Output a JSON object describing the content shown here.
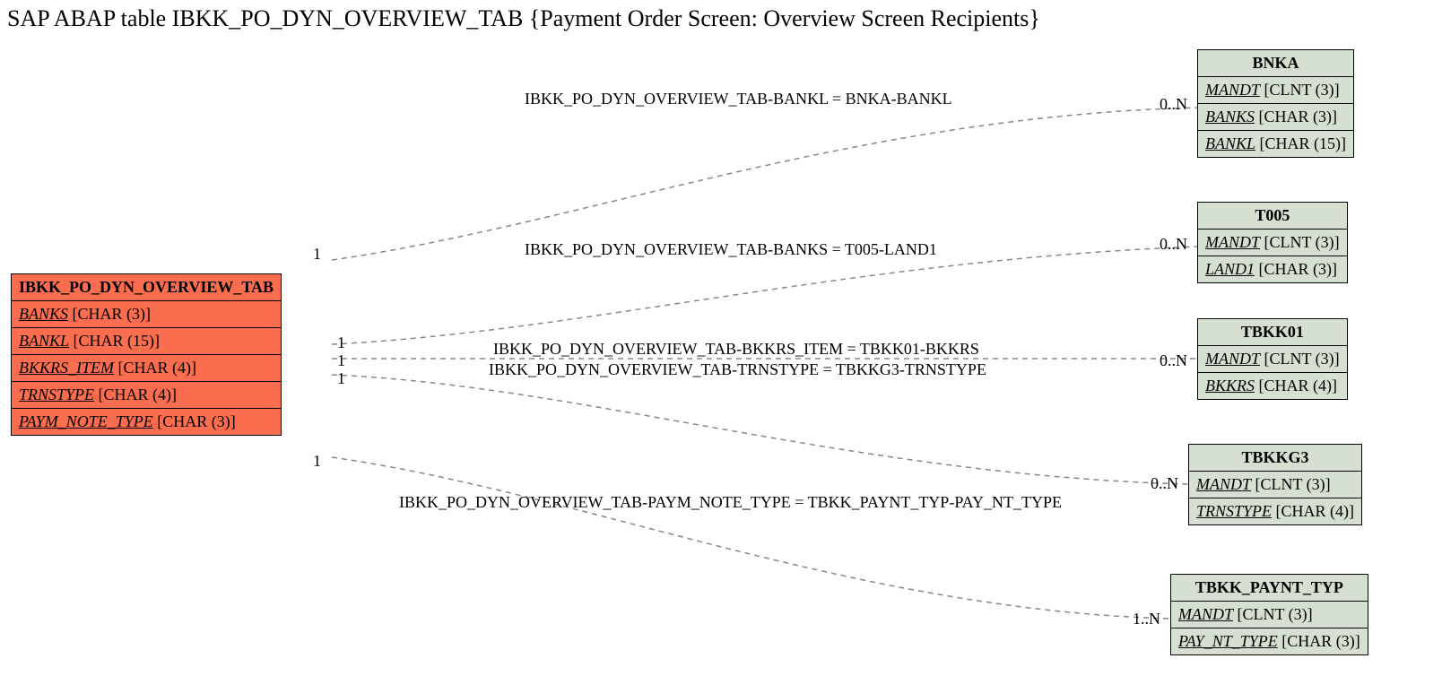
{
  "title": "SAP ABAP table IBKK_PO_DYN_OVERVIEW_TAB {Payment Order Screen: Overview Screen Recipients}",
  "primary": {
    "name": "IBKK_PO_DYN_OVERVIEW_TAB",
    "attrs": [
      {
        "name": "BANKS",
        "type": "[CHAR (3)]"
      },
      {
        "name": "BANKL",
        "type": "[CHAR (15)]"
      },
      {
        "name": "BKKRS_ITEM",
        "type": "[CHAR (4)]"
      },
      {
        "name": "TRNSTYPE",
        "type": "[CHAR (4)]"
      },
      {
        "name": "PAYM_NOTE_TYPE",
        "type": "[CHAR (3)]"
      }
    ]
  },
  "targets": [
    {
      "name": "BNKA",
      "attrs": [
        {
          "name": "MANDT",
          "type": "[CLNT (3)]"
        },
        {
          "name": "BANKS",
          "type": "[CHAR (3)]"
        },
        {
          "name": "BANKL",
          "type": "[CHAR (15)]"
        }
      ]
    },
    {
      "name": "T005",
      "attrs": [
        {
          "name": "MANDT",
          "type": "[CLNT (3)]"
        },
        {
          "name": "LAND1",
          "type": "[CHAR (3)]"
        }
      ]
    },
    {
      "name": "TBKK01",
      "attrs": [
        {
          "name": "MANDT",
          "type": "[CLNT (3)]"
        },
        {
          "name": "BKKRS",
          "type": "[CHAR (4)]"
        }
      ]
    },
    {
      "name": "TBKKG3",
      "attrs": [
        {
          "name": "MANDT",
          "type": "[CLNT (3)]"
        },
        {
          "name": "TRNSTYPE",
          "type": "[CHAR (4)]"
        }
      ]
    },
    {
      "name": "TBKK_PAYNT_TYP",
      "attrs": [
        {
          "name": "MANDT",
          "type": "[CLNT (3)]"
        },
        {
          "name": "PAY_NT_TYPE",
          "type": "[CHAR (3)]"
        }
      ]
    }
  ],
  "edges": [
    {
      "label": "IBKK_PO_DYN_OVERVIEW_TAB-BANKL = BNKA-BANKL",
      "left_card": "1",
      "right_card": "0..N"
    },
    {
      "label": "IBKK_PO_DYN_OVERVIEW_TAB-BANKS = T005-LAND1",
      "left_card": "1",
      "right_card": "0..N"
    },
    {
      "label": "IBKK_PO_DYN_OVERVIEW_TAB-BKKRS_ITEM = TBKK01-BKKRS",
      "left_card": "1",
      "right_card": "0..N"
    },
    {
      "label": "IBKK_PO_DYN_OVERVIEW_TAB-TRNSTYPE = TBKKG3-TRNSTYPE",
      "left_card": "1",
      "right_card": "0..N"
    },
    {
      "label": "IBKK_PO_DYN_OVERVIEW_TAB-PAYM_NOTE_TYPE = TBKK_PAYNT_TYP-PAY_NT_TYPE",
      "left_card": "1",
      "right_card": "1..N"
    }
  ]
}
